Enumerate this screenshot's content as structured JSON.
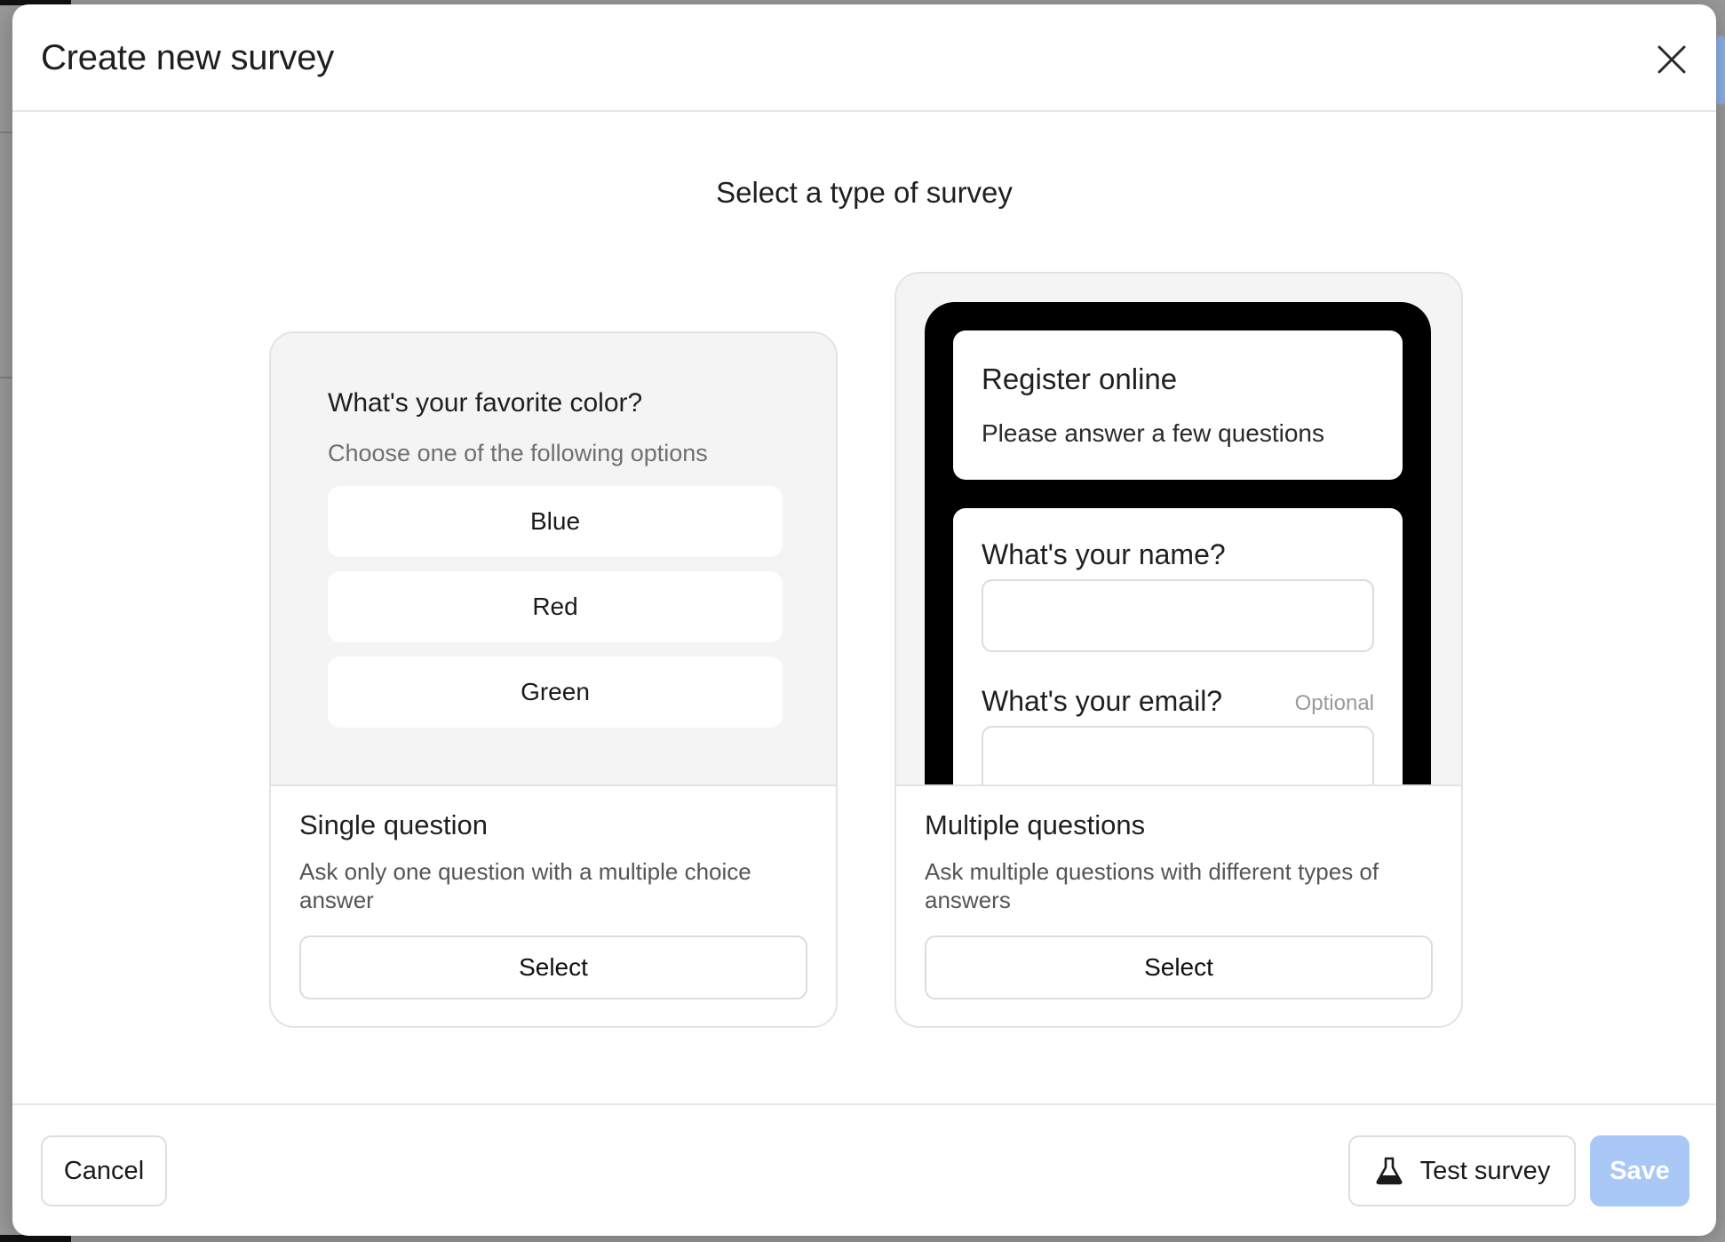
{
  "modal": {
    "title": "Create new survey",
    "section_title": "Select a type of survey"
  },
  "single_card": {
    "preview": {
      "question": "What's your favorite color?",
      "subtitle": "Choose one of the following options",
      "options": [
        "Blue",
        "Red",
        "Green"
      ]
    },
    "heading": "Single question",
    "description": "Ask only one question with a multiple choice answer",
    "select_label": "Select"
  },
  "multi_card": {
    "preview": {
      "title": "Register online",
      "subtitle": "Please answer a few questions",
      "question1": "What's your name?",
      "question2": "What's your email?",
      "optional_label": "Optional"
    },
    "heading": "Multiple questions",
    "description": "Ask multiple questions with different types of answers",
    "select_label": "Select"
  },
  "footer": {
    "cancel_label": "Cancel",
    "test_label": "Test survey",
    "save_label": "Save"
  },
  "colors": {
    "save_disabled": "#a9c8f6",
    "preview_bg": "#f4f4f4"
  },
  "icons": {
    "close": "close-icon",
    "test": "flask-icon"
  }
}
